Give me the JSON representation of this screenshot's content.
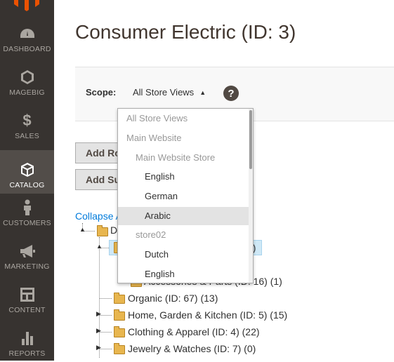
{
  "sidebar": {
    "items": [
      {
        "label": "DASHBOARD",
        "icon": "dashboard-icon"
      },
      {
        "label": "MAGEBIG",
        "icon": "hexagon-icon"
      },
      {
        "label": "SALES",
        "icon": "dollar-icon"
      },
      {
        "label": "CATALOG",
        "icon": "box-icon",
        "active": true
      },
      {
        "label": "CUSTOMERS",
        "icon": "person-icon"
      },
      {
        "label": "MARKETING",
        "icon": "megaphone-icon"
      },
      {
        "label": "CONTENT",
        "icon": "layout-icon"
      },
      {
        "label": "REPORTS",
        "icon": "bar-chart-icon"
      }
    ]
  },
  "page": {
    "title": "Consumer Electric (ID: 3)"
  },
  "scope": {
    "label": "Scope:",
    "current": "All Store Views",
    "arrow": "▲",
    "help": "?"
  },
  "buttons": {
    "add_root": "Add Root Category",
    "add_sub": "Add Subcategory"
  },
  "tree": {
    "collapse_label": "Collapse All",
    "root_label": "D",
    "selected_suffix": "9)",
    "partial_label": "Accessories & Parts (ID: 16) (1)",
    "nodes": [
      "Organic (ID: 67) (13)",
      "Home, Garden & Kitchen (ID: 5) (15)",
      "Clothing & Apparel (ID: 4) (22)",
      "Jewelry & Watches (ID: 7) (0)"
    ]
  },
  "dropdown": {
    "items": [
      {
        "label": "All Store Views",
        "type": "disabled",
        "level": 0
      },
      {
        "label": "Main Website",
        "type": "disabled",
        "level": 0
      },
      {
        "label": "Main Website Store",
        "type": "disabled",
        "level": 1
      },
      {
        "label": "English",
        "type": "option",
        "level": 2
      },
      {
        "label": "German",
        "type": "option",
        "level": 2
      },
      {
        "label": "Arabic",
        "type": "option",
        "level": 2,
        "hover": true
      },
      {
        "label": "store02",
        "type": "disabled",
        "level": 1
      },
      {
        "label": "Dutch",
        "type": "option",
        "level": 2
      },
      {
        "label": "English",
        "type": "option",
        "level": 2
      }
    ]
  },
  "colors": {
    "sidebar_bg": "#373330",
    "sidebar_active": "#524d49",
    "link": "#007bdb",
    "logo": "#eb5202"
  }
}
